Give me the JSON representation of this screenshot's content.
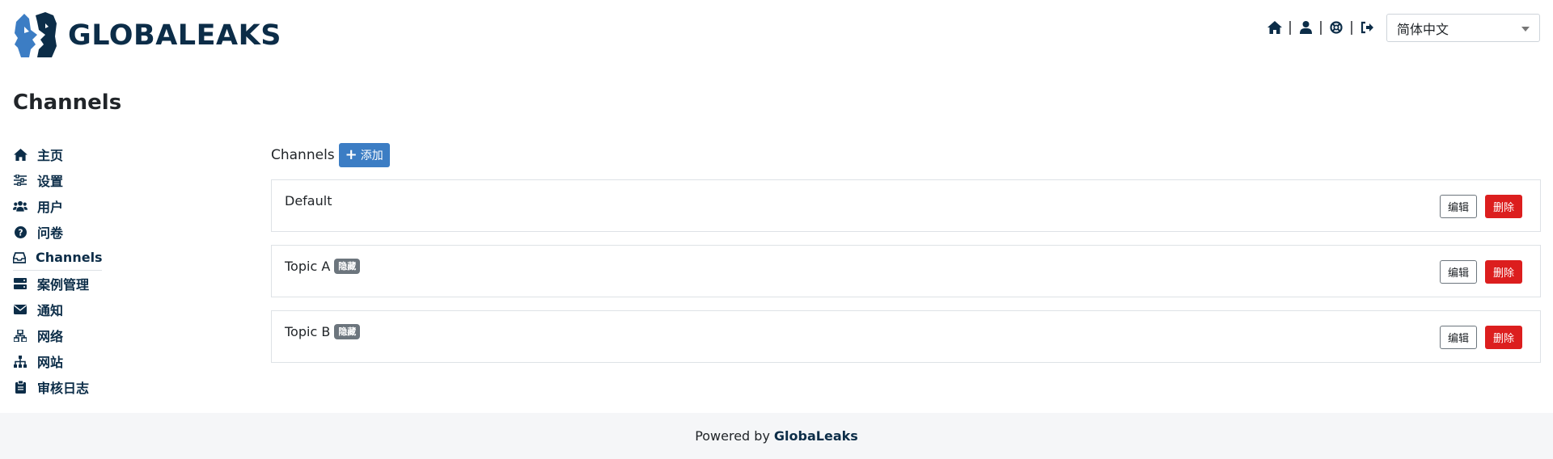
{
  "header": {
    "brand": "GLOBALEAKS",
    "nav_icons": [
      "home-icon",
      "user-icon",
      "support-icon",
      "logout-icon"
    ],
    "nav_separator": "|",
    "language": "简体中文"
  },
  "page": {
    "title": "Channels"
  },
  "sidebar": {
    "items": [
      {
        "label": "主页",
        "icon": "home-icon"
      },
      {
        "label": "设置",
        "icon": "sliders-icon"
      },
      {
        "label": "用户",
        "icon": "users-icon"
      },
      {
        "label": "问卷",
        "icon": "question-circle-icon"
      },
      {
        "label": "Channels",
        "icon": "inbox-icon",
        "active": true
      },
      {
        "label": "案例管理",
        "icon": "server-icon"
      },
      {
        "label": "通知",
        "icon": "envelope-icon"
      },
      {
        "label": "网络",
        "icon": "network-icon"
      },
      {
        "label": "网站",
        "icon": "sitemap-icon"
      },
      {
        "label": "审核日志",
        "icon": "clipboard-icon"
      }
    ]
  },
  "main": {
    "heading": "Channels",
    "add_button": "添加",
    "channels": [
      {
        "name": "Default",
        "badge": ""
      },
      {
        "name": "Topic A",
        "badge": "隐藏"
      },
      {
        "name": "Topic B",
        "badge": "隐藏"
      }
    ],
    "edit_label": "编辑",
    "delete_label": "删除"
  },
  "footer": {
    "prefix": "Powered by",
    "brand": "GlobaLeaks"
  },
  "colors": {
    "brand": "#0c2d48",
    "primary": "#3c7dc4",
    "danger": "#dc1e1e",
    "badge": "#6c757d"
  }
}
